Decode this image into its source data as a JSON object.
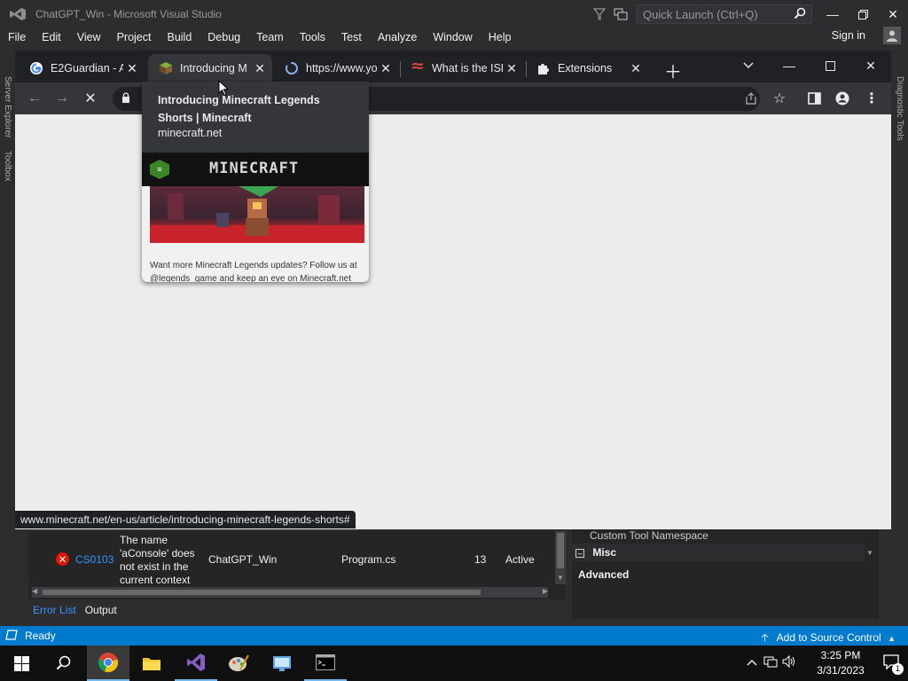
{
  "vs": {
    "title": "ChatGPT_Win - Microsoft Visual Studio",
    "quick_launch_placeholder": "Quick Launch (Ctrl+Q)",
    "menu": [
      "File",
      "Edit",
      "View",
      "Project",
      "Build",
      "Debug",
      "Team",
      "Tools",
      "Test",
      "Analyze",
      "Window",
      "Help"
    ],
    "sign_in": "Sign in",
    "left_strip": [
      "Server Explorer",
      "Toolbox"
    ],
    "right_strip": "Diagnostic Tools"
  },
  "chrome": {
    "tabs": [
      {
        "title": "E2Guardian - A",
        "favicon": "google-icon"
      },
      {
        "title": "Introducing M",
        "favicon": "minecraft-icon",
        "active": true
      },
      {
        "title": "https://www.yo",
        "favicon": "loading-spinner-icon"
      },
      {
        "title": "What is the ISP",
        "favicon": "isp-icon"
      },
      {
        "title": "Extensions",
        "favicon": "puzzle-icon"
      }
    ],
    "hover_card": {
      "title": "Introducing Minecraft Legends Shorts | Minecraft",
      "domain": "minecraft.net",
      "logo_text": "MINECRAFT",
      "caption": "Want more Minecraft Legends updates? Follow us at @legends_game and keep an eye on Minecraft.net"
    },
    "status_url": "www.minecraft.net/en-us/article/introducing-minecraft-legends-shorts#"
  },
  "error_list": {
    "rows": [
      {
        "code": "CS0103",
        "description": "The name 'aConsole' does not exist in the current context",
        "project": "ChatGPT_Win",
        "file": "Program.cs",
        "line": "13",
        "state": "Active"
      }
    ],
    "tabs": [
      "Error List",
      "Output"
    ]
  },
  "properties": {
    "row1": "Custom Tool Namespace",
    "section": "Misc",
    "selected": "Advanced"
  },
  "statusbar": {
    "ready": "Ready",
    "source_control": "Add to Source Control"
  },
  "taskbar": {
    "time": "3:25 PM",
    "date": "3/31/2023",
    "notification_count": "1"
  },
  "colors": {
    "vs_bg": "#2d2d30",
    "status_blue": "#007acc",
    "chrome_frame": "#202124",
    "chrome_toolbar": "#35363a"
  }
}
